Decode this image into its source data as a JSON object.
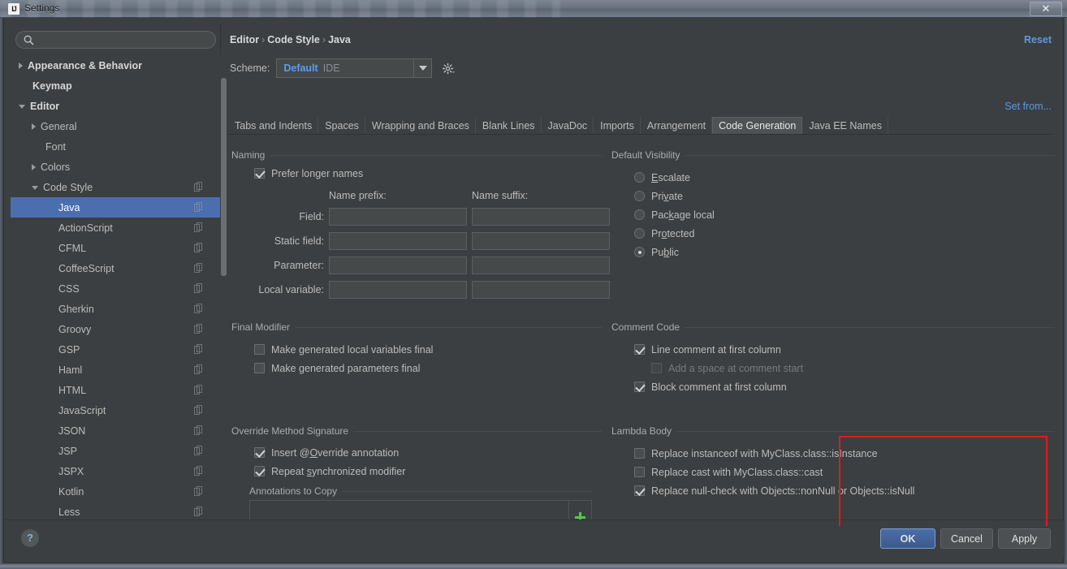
{
  "window": {
    "title": "Settings",
    "icon": "intellij-idea-icon",
    "close_label": "✕"
  },
  "sidebar": {
    "search": {
      "placeholder": "",
      "value": "",
      "icon": "search-icon"
    },
    "items": [
      {
        "label": "Appearance & Behavior",
        "indent": 0,
        "arrow": "closed",
        "bold": true,
        "copy": false,
        "selected": false
      },
      {
        "label": "Keymap",
        "indent": 0,
        "arrow": "none",
        "bold": true,
        "copy": false,
        "selected": false
      },
      {
        "label": "Editor",
        "indent": 0,
        "arrow": "open",
        "bold": true,
        "copy": false,
        "selected": false
      },
      {
        "label": "General",
        "indent": 1,
        "arrow": "closed",
        "bold": false,
        "copy": false,
        "selected": false
      },
      {
        "label": "Font",
        "indent": 1,
        "arrow": "none",
        "bold": false,
        "copy": false,
        "selected": false
      },
      {
        "label": "Colors",
        "indent": 1,
        "arrow": "closed",
        "bold": false,
        "copy": false,
        "selected": false
      },
      {
        "label": "Code Style",
        "indent": 1,
        "arrow": "open",
        "bold": false,
        "copy": true,
        "selected": false
      },
      {
        "label": "Java",
        "indent": 2,
        "arrow": "none",
        "bold": false,
        "copy": true,
        "selected": true
      },
      {
        "label": "ActionScript",
        "indent": 2,
        "arrow": "none",
        "bold": false,
        "copy": true,
        "selected": false
      },
      {
        "label": "CFML",
        "indent": 2,
        "arrow": "none",
        "bold": false,
        "copy": true,
        "selected": false
      },
      {
        "label": "CoffeeScript",
        "indent": 2,
        "arrow": "none",
        "bold": false,
        "copy": true,
        "selected": false
      },
      {
        "label": "CSS",
        "indent": 2,
        "arrow": "none",
        "bold": false,
        "copy": true,
        "selected": false
      },
      {
        "label": "Gherkin",
        "indent": 2,
        "arrow": "none",
        "bold": false,
        "copy": true,
        "selected": false
      },
      {
        "label": "Groovy",
        "indent": 2,
        "arrow": "none",
        "bold": false,
        "copy": true,
        "selected": false
      },
      {
        "label": "GSP",
        "indent": 2,
        "arrow": "none",
        "bold": false,
        "copy": true,
        "selected": false
      },
      {
        "label": "Haml",
        "indent": 2,
        "arrow": "none",
        "bold": false,
        "copy": true,
        "selected": false
      },
      {
        "label": "HTML",
        "indent": 2,
        "arrow": "none",
        "bold": false,
        "copy": true,
        "selected": false
      },
      {
        "label": "JavaScript",
        "indent": 2,
        "arrow": "none",
        "bold": false,
        "copy": true,
        "selected": false
      },
      {
        "label": "JSON",
        "indent": 2,
        "arrow": "none",
        "bold": false,
        "copy": true,
        "selected": false
      },
      {
        "label": "JSP",
        "indent": 2,
        "arrow": "none",
        "bold": false,
        "copy": true,
        "selected": false
      },
      {
        "label": "JSPX",
        "indent": 2,
        "arrow": "none",
        "bold": false,
        "copy": true,
        "selected": false
      },
      {
        "label": "Kotlin",
        "indent": 2,
        "arrow": "none",
        "bold": false,
        "copy": true,
        "selected": false
      },
      {
        "label": "Less",
        "indent": 2,
        "arrow": "none",
        "bold": false,
        "copy": true,
        "selected": false
      }
    ]
  },
  "header": {
    "breadcrumb": [
      "Editor",
      "Code Style",
      "Java"
    ],
    "breadcrumb_separator": "›",
    "reset_label": "Reset",
    "scheme_label": "Scheme:",
    "scheme_value": "Default",
    "scheme_sub": "IDE",
    "gear_icon": "gear-icon",
    "set_from_label": "Set from..."
  },
  "tabs": [
    {
      "label": "Tabs and Indents",
      "selected": false
    },
    {
      "label": "Spaces",
      "selected": false
    },
    {
      "label": "Wrapping and Braces",
      "selected": false
    },
    {
      "label": "Blank Lines",
      "selected": false
    },
    {
      "label": "JavaDoc",
      "selected": false
    },
    {
      "label": "Imports",
      "selected": false
    },
    {
      "label": "Arrangement",
      "selected": false
    },
    {
      "label": "Code Generation",
      "selected": true
    },
    {
      "label": "Java EE Names",
      "selected": false
    }
  ],
  "naming": {
    "title": "Naming",
    "prefer_longer_names": {
      "label": "Prefer longer names",
      "checked": true
    },
    "col_prefix": "Name prefix:",
    "col_suffix": "Name suffix:",
    "rows": [
      {
        "label": "Field:",
        "prefix": "",
        "suffix": ""
      },
      {
        "label": "Static field:",
        "prefix": "",
        "suffix": ""
      },
      {
        "label": "Parameter:",
        "prefix": "",
        "suffix": ""
      },
      {
        "label": "Local variable:",
        "prefix": "",
        "suffix": ""
      }
    ]
  },
  "default_visibility": {
    "title": "Default Visibility",
    "options": [
      {
        "label": "Escalate",
        "mnemonic": "E",
        "checked": false
      },
      {
        "label": "Private",
        "mnemonic": "v",
        "checked": false
      },
      {
        "label": "Package local",
        "mnemonic": "k",
        "checked": false
      },
      {
        "label": "Protected",
        "mnemonic": "o",
        "checked": false
      },
      {
        "label": "Public",
        "mnemonic": "b",
        "checked": true
      }
    ]
  },
  "final_modifier": {
    "title": "Final Modifier",
    "options": [
      {
        "label": "Make generated local variables final",
        "checked": false
      },
      {
        "label": "Make generated parameters final",
        "checked": false
      }
    ]
  },
  "comment_code": {
    "title": "Comment Code",
    "highlighted": true,
    "highlight_color": "#e01b1b",
    "options": [
      {
        "label": "Line comment at first column",
        "checked": true,
        "disabled": false,
        "indent": 0
      },
      {
        "label": "Add a space at comment start",
        "checked": false,
        "disabled": true,
        "indent": 1
      },
      {
        "label": "Block comment at first column",
        "checked": true,
        "disabled": false,
        "indent": 0
      }
    ]
  },
  "override_method_signature": {
    "title": "Override Method Signature",
    "options": [
      {
        "label": "Insert @Override annotation",
        "checked": true
      },
      {
        "label": "Repeat synchronized modifier",
        "checked": true
      }
    ],
    "annotations_to_copy": {
      "title": "Annotations to Copy",
      "items": [],
      "add_icon": "plus-icon"
    }
  },
  "lambda_body": {
    "title": "Lambda Body",
    "options": [
      {
        "label": "Replace instanceof with MyClass.class::isInstance",
        "checked": false
      },
      {
        "label": "Replace cast with MyClass.class::cast",
        "checked": false
      },
      {
        "label": "Replace null-check with Objects::nonNull or Objects::isNull",
        "checked": true
      }
    ]
  },
  "footer": {
    "help_label": "?",
    "ok_label": "OK",
    "cancel_label": "Cancel",
    "apply_label": "Apply"
  },
  "colors": {
    "accent_blue": "#589df6",
    "selection_blue": "#4b6eaf",
    "panel_bg": "#3c3f41",
    "highlight_red": "#e01b1b",
    "add_green": "#4ec94e"
  }
}
